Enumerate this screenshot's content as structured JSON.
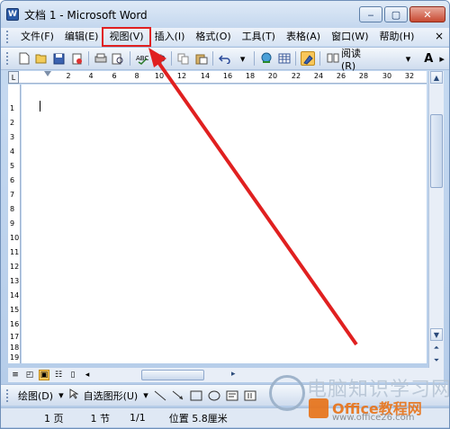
{
  "window": {
    "title": "文档 1 - Microsoft Word"
  },
  "titlebar": {
    "app_icon": "W",
    "minimize": "‒",
    "maximize": "▢",
    "close": "✕"
  },
  "menu": {
    "items": [
      "文件(F)",
      "编辑(E)",
      "视图(V)",
      "插入(I)",
      "格式(O)",
      "工具(T)",
      "表格(A)",
      "窗口(W)",
      "帮助(H)"
    ],
    "highlighted": "视图(V)",
    "close_doc": "×"
  },
  "toolbar": {
    "read_label": "阅读(R)",
    "font_size_icon": "A"
  },
  "ruler": {
    "corner": "L",
    "top_numbers": [
      "2",
      "4",
      "6",
      "8",
      "10",
      "12",
      "14",
      "16",
      "18",
      "20",
      "22",
      "24",
      "26",
      "28",
      "30",
      "32"
    ],
    "left_numbers": [
      "1",
      "2",
      "3",
      "4",
      "5",
      "6",
      "7",
      "8",
      "9",
      "10",
      "11",
      "12",
      "13",
      "14",
      "15",
      "16",
      "17",
      "18",
      "19"
    ]
  },
  "drawing_toolbar": {
    "draw_label": "绘图(D)",
    "autoshapes_label": "自选图形(U)"
  },
  "status": {
    "page": "1 页",
    "section": "1 节",
    "page_of": "1/1",
    "position": "位置 5.8厘米"
  },
  "watermark": {
    "text_cn": "电脑知识学习网",
    "text_brand": "Office教程网",
    "url": "www.office26.com"
  },
  "colors": {
    "annotation_red": "#e02020",
    "title_gradient_top": "#dfeaf7",
    "status_bg": "#dfe8f4"
  }
}
